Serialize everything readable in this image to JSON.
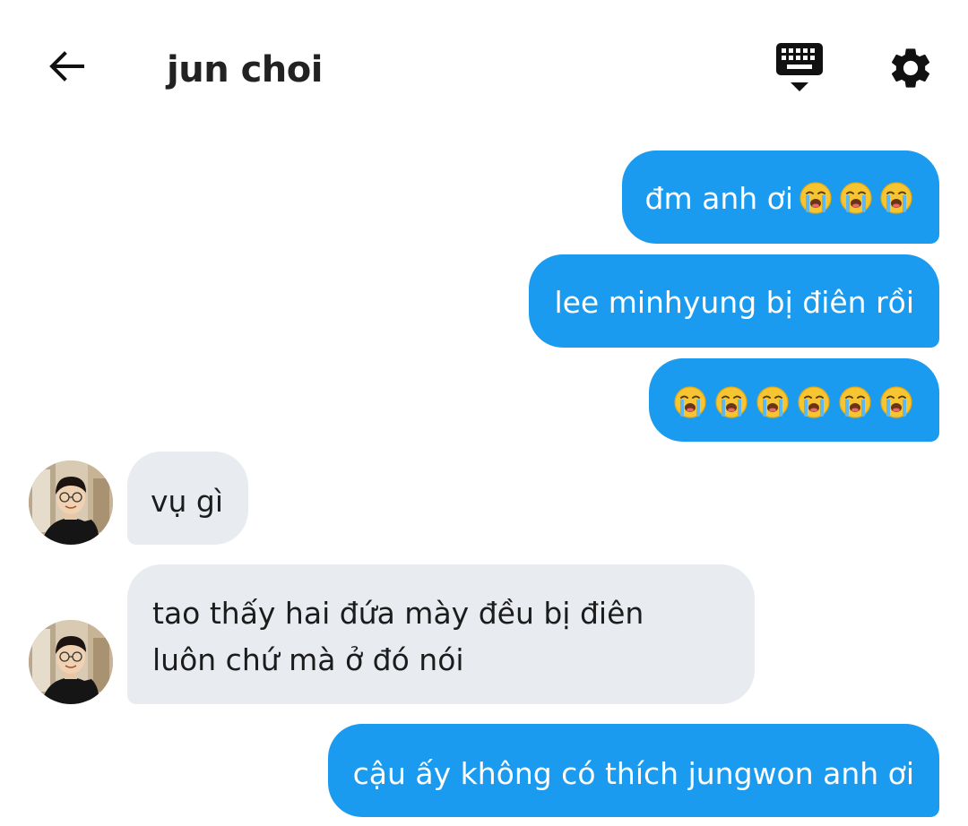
{
  "header": {
    "title": "jun choi",
    "back_icon": "arrow-left-icon",
    "keyboard_icon": "keyboard-hide-icon",
    "settings_icon": "gear-icon"
  },
  "colors": {
    "outgoing_bubble": "#1a9bf0",
    "incoming_bubble": "#e8ecf0",
    "text_dark": "#222222"
  },
  "messages": [
    {
      "direction": "out",
      "text": "đm anh ơi",
      "emoji": [
        "loudly-crying-face",
        "loudly-crying-face",
        "loudly-crying-face"
      ]
    },
    {
      "direction": "out",
      "text": "lee minhyung bị điên rồi"
    },
    {
      "direction": "out",
      "text": "",
      "emoji": [
        "loudly-crying-face",
        "loudly-crying-face",
        "loudly-crying-face",
        "loudly-crying-face",
        "loudly-crying-face",
        "loudly-crying-face"
      ]
    },
    {
      "direction": "in",
      "text": "vụ gì"
    },
    {
      "direction": "in",
      "text": "tao thấy hai đứa mày đều bị điên luôn chứ mà ở đó nói"
    },
    {
      "direction": "out",
      "text": "cậu ấy không có thích jungwon anh ơi"
    }
  ]
}
